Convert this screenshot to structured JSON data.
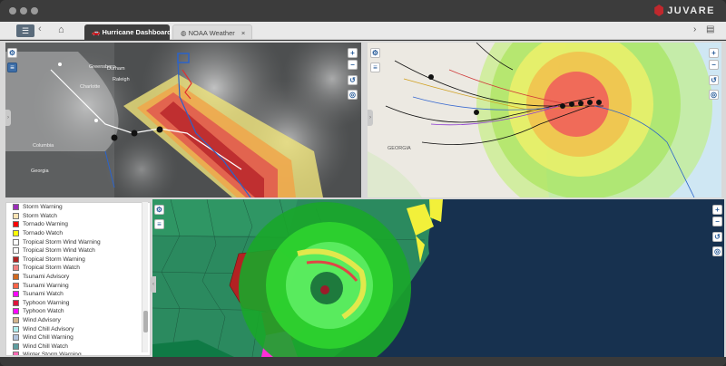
{
  "window": {
    "brand": "JUVARE"
  },
  "toolbar": {
    "menu_icon": "menu-icon",
    "back_icon": "chevron-left-icon",
    "home_icon": "home-icon",
    "export_icon": "export-icon"
  },
  "tabs": [
    {
      "label": "Hurricane Dashboard",
      "icon": "car-icon",
      "active": true
    },
    {
      "label": "NOAA Weather",
      "icon": "globe-icon",
      "active": false
    }
  ],
  "map_top_left": {
    "place_labels": [
      "Greensboro",
      "Raleigh",
      "Columbia",
      "Georgia",
      "Charlotte",
      "Durham"
    ]
  },
  "map_top_right": {
    "place_labels": [
      "GEORGIA"
    ]
  },
  "legend": {
    "items": [
      {
        "label": "Storm Warning",
        "color": "#9b2dba"
      },
      {
        "label": "Storm Watch",
        "color": "#ffe4b5"
      },
      {
        "label": "Tornado Warning",
        "color": "#ff0000"
      },
      {
        "label": "Tornado Watch",
        "color": "#ffff00"
      },
      {
        "label": "Tropical Storm Wind Warning",
        "color": "#ffffff"
      },
      {
        "label": "Tropical Storm Wind Watch",
        "color": "#ffffff"
      },
      {
        "label": "Tropical Storm Warning",
        "color": "#b22222"
      },
      {
        "label": "Tropical Storm Watch",
        "color": "#f08080"
      },
      {
        "label": "Tsunami Advisory",
        "color": "#d2691e"
      },
      {
        "label": "Tsunami Warning",
        "color": "#fd6347"
      },
      {
        "label": "Tsunami Watch",
        "color": "#ff00ff"
      },
      {
        "label": "Typhoon Warning",
        "color": "#dc143c"
      },
      {
        "label": "Typhoon Watch",
        "color": "#ff00ff"
      },
      {
        "label": "Wind Advisory",
        "color": "#d2b48c"
      },
      {
        "label": "Wind Chill Advisory",
        "color": "#afeeee"
      },
      {
        "label": "Wind Chill Warning",
        "color": "#b0c4de"
      },
      {
        "label": "Wind Chill Watch",
        "color": "#5f9ea0"
      },
      {
        "label": "Winter Storm Warning",
        "color": "#ff69b4"
      }
    ]
  }
}
